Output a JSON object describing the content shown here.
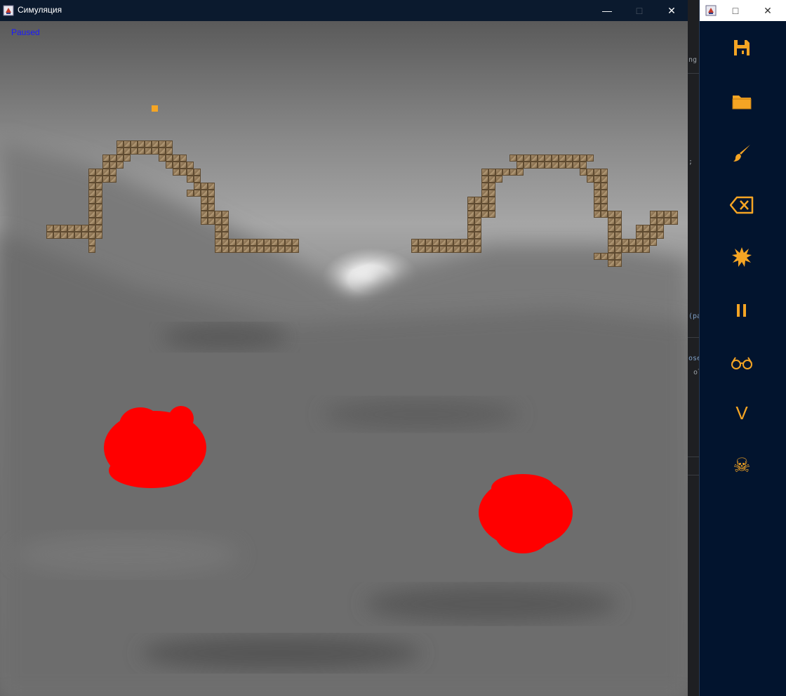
{
  "window": {
    "title": "Симуляция",
    "minimize": "—",
    "maximize": "□",
    "close": "✕"
  },
  "status": "Paused",
  "toolbar": {
    "title": "",
    "maximize": "□",
    "close": "✕",
    "tools": [
      {
        "name": "save",
        "icon": "floppy-disk-icon"
      },
      {
        "name": "open",
        "icon": "folder-icon"
      },
      {
        "name": "brush",
        "icon": "brush-icon"
      },
      {
        "name": "eraser",
        "icon": "eraser-icon"
      },
      {
        "name": "explode",
        "icon": "explosion-icon"
      },
      {
        "name": "pause",
        "icon": "pause-icon"
      },
      {
        "name": "view",
        "icon": "glasses-icon"
      },
      {
        "name": "v",
        "icon": "letter-v",
        "label": "V"
      },
      {
        "name": "kill",
        "icon": "skull-crossbones-icon",
        "label": "☠"
      }
    ]
  },
  "ide_fragments": [
    "ng",
    ";",
    "(pa",
    "ose",
    "ol"
  ],
  "colors": {
    "particle": "#f5a524",
    "blob": "#ff0000",
    "tool_icon": "#f5a524",
    "titlebar": "#0b1a2e",
    "status": "#1a1aff"
  }
}
